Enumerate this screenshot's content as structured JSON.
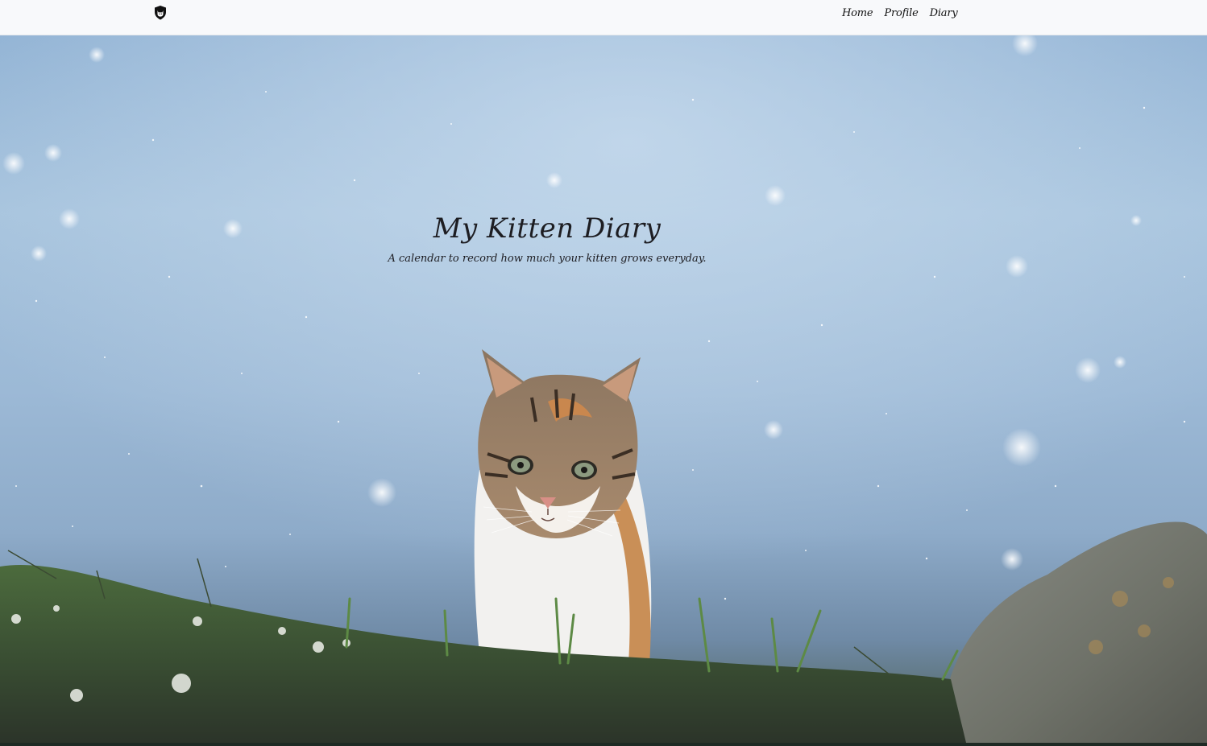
{
  "navbar": {
    "brand_icon": "cat-shield-icon",
    "links": [
      {
        "label": "Home"
      },
      {
        "label": "Profile"
      },
      {
        "label": "Diary"
      }
    ],
    "background": "#f8f9fb"
  },
  "hero": {
    "title": "My Kitten Diary",
    "subtitle": "A calendar to record how much your kitten grows everyday.",
    "image": "kitten-in-grass-snow-photo",
    "sky_color": "#9cb9d6",
    "grass_color": "#3f5a3a"
  }
}
